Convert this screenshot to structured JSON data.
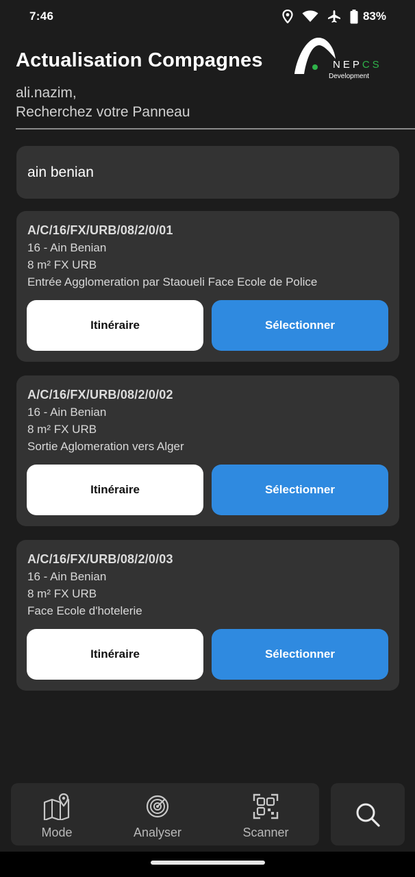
{
  "status_bar": {
    "time": "7:46",
    "battery": "83%",
    "icons": [
      "location-icon",
      "wifi-icon",
      "airplane-icon",
      "battery-icon"
    ]
  },
  "header": {
    "title": "Actualisation Compagnes",
    "logo": {
      "word_main": "NEP",
      "word_accent": "CS",
      "sub": "Development",
      "accent_color": "#2fb34a"
    },
    "greeting_user": "ali.nazim,",
    "greeting_prompt": "Recherchez votre Panneau"
  },
  "search": {
    "value": "ain benian"
  },
  "results": [
    {
      "code": "A/C/16/FX/URB/08/2/0/01",
      "commune": "16 - Ain Benian",
      "format": "8 m² FX URB",
      "location": "Entrée Agglomeration par Staoueli Face Ecole de Police",
      "route_label": "Itinéraire",
      "select_label": "Sélectionner"
    },
    {
      "code": "A/C/16/FX/URB/08/2/0/02",
      "commune": "16 - Ain Benian",
      "format": "8 m² FX URB",
      "location": "Sortie Aglomeration vers Alger",
      "route_label": "Itinéraire",
      "select_label": "Sélectionner"
    },
    {
      "code": "A/C/16/FX/URB/08/2/0/03",
      "commune": "16 - Ain Benian",
      "format": "8 m² FX URB",
      "location": "Face Ecole d'hotelerie",
      "route_label": "Itinéraire",
      "select_label": "Sélectionner"
    }
  ],
  "bottom_nav": {
    "items": [
      {
        "label": "Mode",
        "icon": "map-pin-icon"
      },
      {
        "label": "Analyser",
        "icon": "radar-icon"
      },
      {
        "label": "Scanner",
        "icon": "qr-code-icon"
      }
    ],
    "search_icon": "search-icon"
  },
  "colors": {
    "background": "#1c1c1c",
    "card": "#333333",
    "primary_button": "#2f8ae0",
    "secondary_button": "#ffffff"
  }
}
